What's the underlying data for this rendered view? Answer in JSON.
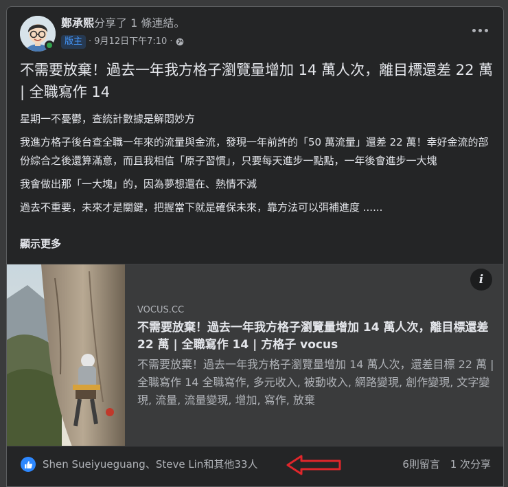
{
  "post": {
    "author": "鄭承熙",
    "action": "分享了 1 條連結。",
    "badge": "版主",
    "timestamp": "· 9月12日下午7:10 ·",
    "privacy_icon": "globe-icon",
    "title": "不需要放棄！過去一年我方格子瀏覽量增加 14 萬人次，離目標還差 22 萬 | 全職寫作 14",
    "paragraphs": [
      "星期一不憂鬱，查統計數據是解悶妙方",
      "我進方格子後台查全職一年來的流量與金流，發現一年前許的「50 萬流量」還差 22 萬！幸好金流的部份綜合之後還算滿意，而且我相信「原子習慣」，只要每天進步一點點，一年後會進步一大塊",
      "我會做出那「一大塊」的，因為夢想還在、熱情不減",
      "過去不重要，未來才是關鍵，把握當下就是確保未來，靠方法可以弭補進度 ......"
    ],
    "see_more": "顯示更多"
  },
  "link": {
    "domain": "VOCUS.CC",
    "title": "不需要放棄！過去一年我方格子瀏覽量增加 14 萬人次，離目標還差 22 萬 | 全職寫作 14 | 方格子 vocus",
    "description": "不需要放棄！過去一年我方格子瀏覽量增加 14 萬人次，還差目標 22 萬 | 全職寫作 14 全職寫作, 多元收入, 被動收入, 網路變現, 創作變現, 文字變現, 流量, 流量變現, 增加, 寫作, 放棄",
    "info_icon": "i"
  },
  "footer": {
    "reactors": "Shen Sueiyueguang、Steve Lin和其他33人",
    "comments": "6則留言",
    "shares": "1 次分享"
  },
  "colors": {
    "background": "#242526",
    "accent": "#2d88ff",
    "badge_text": "#4599ff",
    "annotation_arrow": "#e0262b"
  }
}
